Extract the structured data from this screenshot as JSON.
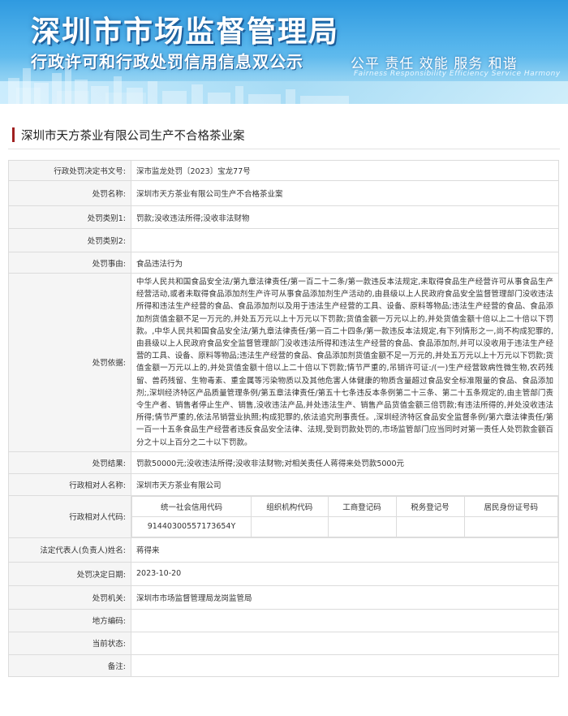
{
  "banner": {
    "title": "深圳市市场监督管理局",
    "subtitle": "行政许可和行政处罚信用信息双公示",
    "slogan": "公平  责任  效能  服务  和谐",
    "slogan_en": "Fairness  Responsibility  Efficiency  Service  Harmony"
  },
  "case_title": "深圳市天方茶业有限公司生产不合格茶业案",
  "fields": {
    "doc_no": {
      "label": "行政处罚决定书文号:",
      "value": "深市监龙处罚〔2023〕宝龙77号"
    },
    "case_name": {
      "label": "处罚名称:",
      "value": "深圳市天方茶业有限公司生产不合格茶业案"
    },
    "category1": {
      "label": "处罚类别1:",
      "value": "罚款;没收违法所得;没收非法财物"
    },
    "category2": {
      "label": "处罚类别2:",
      "value": ""
    },
    "reason": {
      "label": "处罚事由:",
      "value": "食品违法行为"
    },
    "basis": {
      "label": "处罚依据:",
      "value": "中华人民共和国食品安全法/第九章法律责任/第一百二十二条/第一款违反本法规定,未取得食品生产经营许可从事食品生产经营活动,或者未取得食品添加剂生产许可从事食品添加剂生产活动的,由县级以上人民政府食品安全监督管理部门没收违法所得和违法生产经营的食品、食品添加剂以及用于违法生产经营的工具、设备、原料等物品;违法生产经营的食品、食品添加剂货值金额不足一万元的,并处五万元以上十万元以下罚款;货值金额一万元以上的,并处货值金额十倍以上二十倍以下罚款。,中华人民共和国食品安全法/第九章法律责任/第一百二十四条/第一款违反本法规定,有下列情形之一,尚不构成犯罪的,由县级以上人民政府食品安全监督管理部门没收违法所得和违法生产经营的食品、食品添加剂,并可以没收用于违法生产经营的工具、设备、原料等物品;违法生产经营的食品、食品添加剂货值金额不足一万元的,并处五万元以上十万元以下罚款;货值金额一万元以上的,并处货值金额十倍以上二十倍以下罚款;情节严重的,吊销许可证:/(一)生产经营致病性微生物,农药残留、兽药残留、生物毒素、重金属等污染物质以及其他危害人体健康的物质含量超过食品安全标准限量的食品、食品添加剂;,深圳经济特区产品质量管理条例/第五章法律责任/第五十七条违反本条例第二十三条、第二十五条规定的,由主管部门责令生产者、销售者停止生产、销售,没收违法产品,并处违法生产、销售产品货值金额三倍罚款;有违法所得的,并处没收违法所得;情节严重的,依法吊销营业执照;构成犯罪的,依法追究刑事责任。,深圳经济特区食品安全监督条例/第六章法律责任/第一百一十五条食品生产经营者违反食品安全法律、法规,受到罚款处罚的,市场监管部门应当同时对第一责任人处罚款金额百分之十以上百分之二十以下罚款。"
    },
    "result": {
      "label": "处罚结果:",
      "value": "罚款50000元;没收违法所得;没收非法财物;对相关责任人蒋得来处罚款5000元"
    },
    "counterparty": {
      "label": "行政相对人名称:",
      "value": "深圳市天方茶业有限公司"
    },
    "codes": {
      "label": "行政相对人代码:",
      "headers": [
        "统一社会信用代码",
        "组织机构代码",
        "工商登记码",
        "税务登记号",
        "居民身份证号码"
      ],
      "values": [
        "91440300557173654Y",
        "",
        "",
        "",
        ""
      ]
    },
    "legal_rep": {
      "label": "法定代表人(负责人)姓名:",
      "value": "蒋得来"
    },
    "decision_date": {
      "label": "处罚决定日期:",
      "value": "2023-10-20"
    },
    "authority": {
      "label": "处罚机关:",
      "value": "深圳市市场监督管理局龙岗监管局"
    },
    "area_code": {
      "label": "地方编码:",
      "value": ""
    },
    "status": {
      "label": "当前状态:",
      "value": ""
    },
    "remarks": {
      "label": "备注:",
      "value": ""
    }
  },
  "colors": {
    "accent_bar": "#a02020",
    "label_bg": "#f5f5f5",
    "border": "#dcdcdc",
    "banner_blue": "#2f9ae0"
  }
}
